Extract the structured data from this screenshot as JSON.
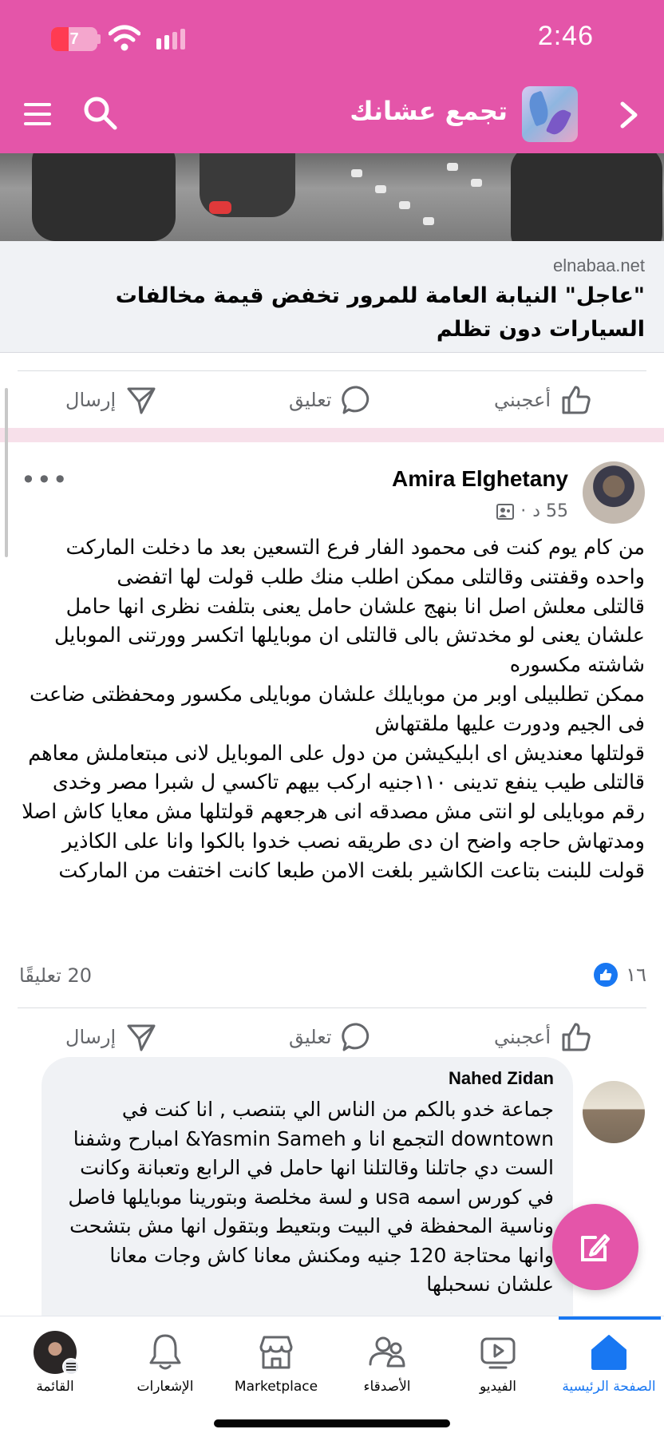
{
  "status_bar": {
    "time": "2:46",
    "battery_level": "7",
    "battery_color": "#ff3b52"
  },
  "header": {
    "title": "تجمع عشانك",
    "background": "#e455a9",
    "icons": [
      "menu-icon",
      "search-icon",
      "chevron-right-icon"
    ]
  },
  "link_preview": {
    "domain": "elnabaa.net",
    "title": "\"عاجل\" النيابة العامة للمرور تخفض قيمة مخالفات السيارات دون تظلم"
  },
  "actions": {
    "like": "أعجبني",
    "comment": "تعليق",
    "send": "إرسال"
  },
  "post": {
    "author": "Amira Elghetany",
    "time": "55 د",
    "text": "من كام يوم كنت فى محمود الفار فرع التسعين  بعد ما دخلت الماركت واحده وقفتنى  وقالتلى ممكن اطلب منك طلب قولت لها اتفضى\nقالتلى معلش اصل انا بنهج علشان حامل  يعنى بتلفت نظرى انها حامل علشان يعنى لو مخدتش بالى قالتلى ان موبايلها اتكسر وورتنى  الموبايل شاشته مكسوره\n ممكن تطلبيلى اوبر  من موبايلك علشان موبايلى مكسور ومحفظتى ضاعت فى الجيم ودورت عليها ملقتهاش\n قولتلها  معنديش اى ابليكيشن من دول على الموبايل   لانى مبتعاملش معاهم\nقالتلى طيب ينفع تدينى ١١٠جنيه اركب بيهم تاكسي ل شبرا مصر  وخدى رقم موبايلى لو انتى مش مصدقه انى هرجعهم قولتلها مش معايا كاش اصلا ومدتهاش حاجه  واضح ان دى طريقه نصب خدوا بالكوا وانا على الكاذير قولت للبنت بتاعت الكاشير  بلغت الامن طبعا كانت اختفت من الماركت",
    "likes": "١٦",
    "comments": "20 تعليقًا"
  },
  "comment": {
    "author": "Nahed Zidan",
    "text": "جماعة خدو بالكم من الناس الي بتنصب  , انا كنت في downtown التجمع  انا و Yasmin Sameh& امبارح وشفنا الست دي جاتلنا  وقالتلنا انها حامل في الرابع وتعبانة وكانت في كورس اسمه usa و لسة مخلصة وبتورينا موبايلها فاصل وناسية المحفظة في البيت وبتعيط وبتقول انها مش بتشحت وانها محتاجة 120 جنيه ومكنش معانا كاش وجات معانا علشان نسحبلها"
  },
  "bottom_nav": {
    "items": [
      {
        "label": "القائمة",
        "icon": "profile-avatar-icon"
      },
      {
        "label": "الإشعارات",
        "icon": "bell-icon"
      },
      {
        "label": "Marketplace",
        "icon": "store-icon"
      },
      {
        "label": "الأصدقاء",
        "icon": "friends-icon"
      },
      {
        "label": "الفيديو",
        "icon": "video-icon"
      },
      {
        "label": "الصفحة الرئيسية",
        "icon": "home-icon"
      }
    ],
    "active_color": "#1877f2"
  }
}
